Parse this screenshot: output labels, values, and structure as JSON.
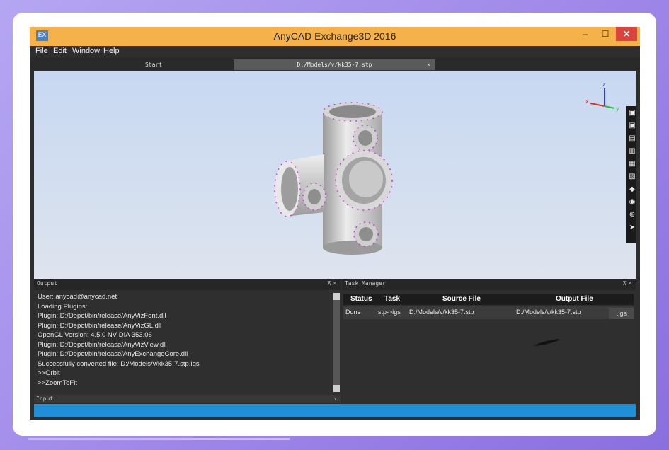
{
  "window": {
    "title": "AnyCAD Exchange3D 2016",
    "icon_text": "EX"
  },
  "window_controls": {
    "minimize": "–",
    "maximize": "☐",
    "close": "✕"
  },
  "menu": [
    {
      "label": "File"
    },
    {
      "label": "Edit"
    },
    {
      "label": "Window"
    },
    {
      "label": "Help"
    }
  ],
  "tabs": {
    "start": "Start",
    "file": "D:/Models/v/kk35-7.stp",
    "close": "×"
  },
  "viewport": {
    "axis_labels": {
      "z": "z",
      "x": "x",
      "y": "y"
    },
    "colors": {
      "background_top": "#c8d8f2",
      "edge_highlight": "#d23bd9",
      "model": "#d9d9d9"
    }
  },
  "view_toolbar": [
    "cube-front-icon",
    "cube-back-icon",
    "cube-top-icon",
    "cube-bottom-icon",
    "cube-left-icon",
    "cube-right-icon",
    "cube-iso-icon",
    "shaded-icon",
    "wireframe-icon",
    "select-cursor-icon"
  ],
  "output": {
    "title": "Output",
    "pins": "⊼ ×",
    "lines": [
      "User: anycad@anycad.net",
      "Loading Plugins:",
      "Plugin: D:/Depot/bin/release/AnyVizFont.dll",
      "Plugin: D:/Depot/bin/release/AnyVizGL.dll",
      "OpenGL Version: 4.5.0 NVIDIA 353.06",
      "Plugin: D:/Depot/bin/release/AnyVizView.dll",
      "Plugin: D:/Depot/bin/release/AnyExchangeCore.dll",
      "Successfully converted file: D:/Models/v/kk35-7.stp.igs",
      ">>Orbit",
      ">>ZoomToFit"
    ],
    "input_label": "Input:",
    "input_arrow": "›"
  },
  "task_manager": {
    "title": "Task Manager",
    "pins": "⊼ ×",
    "columns": [
      "Status",
      "Task",
      "Source File",
      "Output File"
    ],
    "rows": [
      {
        "status": "Done",
        "task": "stp->igs",
        "source": "D:/Models/v/kk35-7.stp",
        "output": "D:/Models/v/kk35-7.stp"
      }
    ],
    "extra_cell": ".igs"
  },
  "colors": {
    "title_bar": "#f5b14a",
    "status_bar": "#1e8fd8",
    "close_button": "#d9443d",
    "dark_panel": "#2e2e2e"
  }
}
